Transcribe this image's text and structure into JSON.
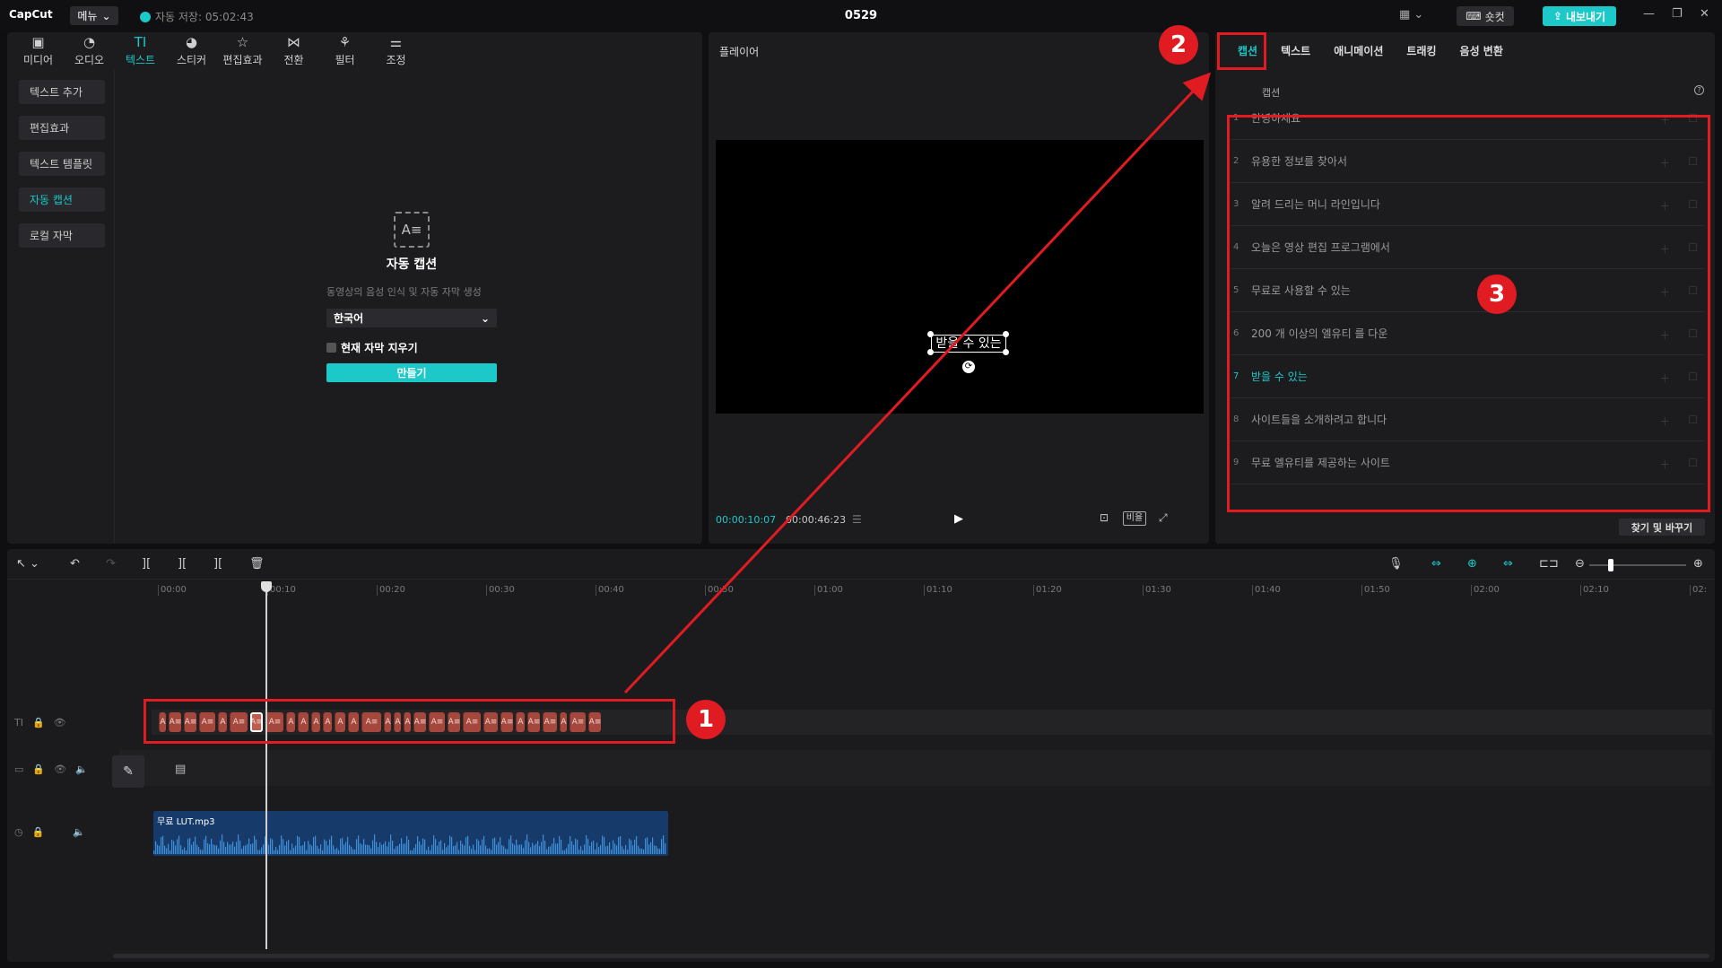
{
  "titlebar": {
    "logo": "CapCut",
    "menu_label": "메뉴",
    "autosave": "자동 저장: 05:02:43",
    "title": "0529",
    "shortcut_label": "숏컷",
    "export_label": "내보내기"
  },
  "toolbar": {
    "tools": [
      {
        "label": "미디어",
        "icon": "media-icon"
      },
      {
        "label": "오디오",
        "icon": "audio-icon"
      },
      {
        "label": "텍스트",
        "icon": "text-icon"
      },
      {
        "label": "스티커",
        "icon": "sticker-icon"
      },
      {
        "label": "편집효과",
        "icon": "effects-icon"
      },
      {
        "label": "전환",
        "icon": "transition-icon"
      },
      {
        "label": "필터",
        "icon": "filter-icon"
      },
      {
        "label": "조정",
        "icon": "adjust-icon"
      }
    ],
    "active": "텍스트"
  },
  "sidebar": {
    "items": [
      {
        "label": "텍스트 추가"
      },
      {
        "label": "편집효과"
      },
      {
        "label": "텍스트 템플릿"
      },
      {
        "label": "자동 캡션"
      },
      {
        "label": "로컬 자막"
      }
    ],
    "active": "자동 캡션"
  },
  "auto_caption": {
    "title": "자동 캡션",
    "description": "동영상의 음성 인식 및 자동 자막 생성",
    "language": "한국어",
    "clear_label": "현재 자막 지우기",
    "create_label": "만들기"
  },
  "player": {
    "title": "플레이어",
    "caption_overlay": "받을 수 있는",
    "time_current": "00:00:10:07",
    "time_total": "00:00:46:23",
    "ratio_label": "비율"
  },
  "right_panel": {
    "tabs": [
      "캡션",
      "텍스트",
      "애니메이션",
      "트래킹",
      "음성 변환"
    ],
    "active_tab": "캡션",
    "section_label": "캡션",
    "captions": [
      {
        "num": "1",
        "text": "안녕하세요"
      },
      {
        "num": "2",
        "text": "유용한 정보를 찾아서"
      },
      {
        "num": "3",
        "text": "알려 드리는 머니 라인입니다"
      },
      {
        "num": "4",
        "text": "오늘은 영상 편집 프로그램에서"
      },
      {
        "num": "5",
        "text": "무료로 사용할 수 있는"
      },
      {
        "num": "6",
        "text": "200 개 이상의 엘유티 를 다운"
      },
      {
        "num": "7",
        "text": "받을 수 있는"
      },
      {
        "num": "8",
        "text": "사이트들을 소개하려고 합니다"
      },
      {
        "num": "9",
        "text": "무료 엘유티를 제공하는 사이트"
      }
    ],
    "active_caption": "7",
    "find_replace_label": "찾기 및 바꾸기"
  },
  "timeline": {
    "ticks": [
      "00:00",
      "00:10",
      "00:20",
      "00:30",
      "00:40",
      "00:50",
      "01:00",
      "01:10",
      "01:20",
      "01:30",
      "01:40",
      "01:50",
      "02:00",
      "02:10",
      "02:"
    ],
    "audio_clip_name": "무료 LUT.mp3",
    "caption_clip_glyph": "A",
    "caption_clip_label": "A≡"
  },
  "annotations": [
    "1",
    "2",
    "3"
  ],
  "colors": {
    "accent": "#1cc8c8",
    "annotation": "#e11b22",
    "caption_clip": "#a6473d",
    "audio_clip": "#163b6b"
  }
}
